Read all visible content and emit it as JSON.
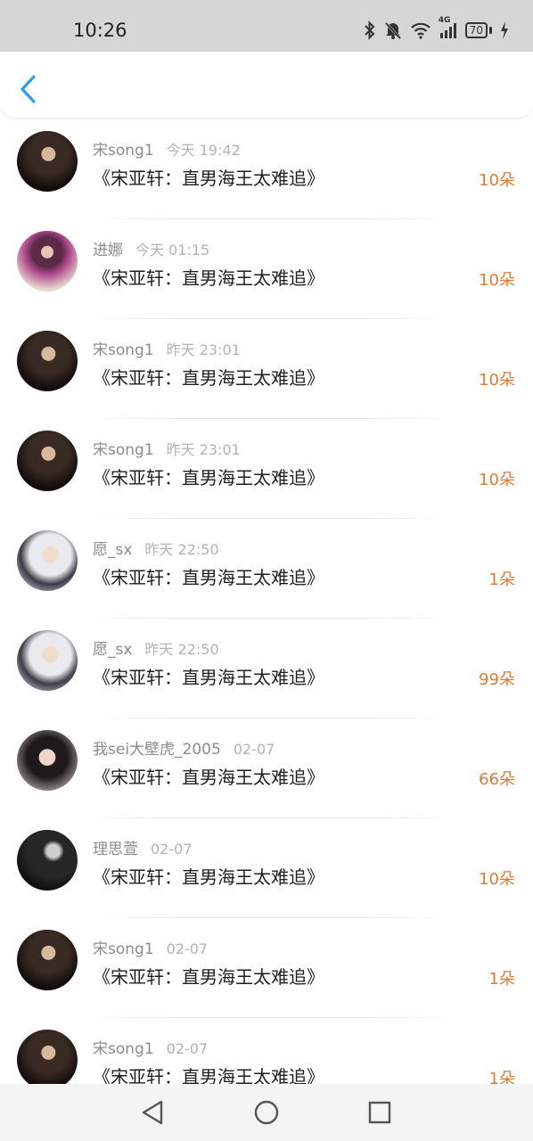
{
  "status_bar": {
    "time": "10:26",
    "network_label": "4G",
    "battery": "70",
    "icons": [
      "bluetooth-icon",
      "mute-icon",
      "wifi-icon",
      "signal-icon",
      "battery-icon",
      "charging-icon"
    ]
  },
  "header": {
    "back_icon": "chevron-left-icon"
  },
  "colors": {
    "accent": "#2a9df4",
    "count": "#e07a32",
    "name": "#8c8c8c"
  },
  "rows": [
    {
      "name": "宋song1",
      "time": "今天 19:42",
      "title": "《宋亚轩：直男海王太难追》",
      "count": "10朵"
    },
    {
      "name": "进娜",
      "time": "今天 01:15",
      "title": "《宋亚轩：直男海王太难追》",
      "count": "10朵"
    },
    {
      "name": "宋song1",
      "time": "昨天 23:01",
      "title": "《宋亚轩：直男海王太难追》",
      "count": "10朵"
    },
    {
      "name": "宋song1",
      "time": "昨天 23:01",
      "title": "《宋亚轩：直男海王太难追》",
      "count": "10朵"
    },
    {
      "name": "愿_sx",
      "time": "昨天 22:50",
      "title": "《宋亚轩：直男海王太难追》",
      "count": "1朵"
    },
    {
      "name": "愿_sx",
      "time": "昨天 22:50",
      "title": "《宋亚轩：直男海王太难追》",
      "count": "99朵"
    },
    {
      "name": "我sei大壁虎_2005",
      "time": "02-07",
      "title": "《宋亚轩：直男海王太难追》",
      "count": "66朵"
    },
    {
      "name": "理思萱",
      "time": "02-07",
      "title": "《宋亚轩：直男海王太难追》",
      "count": "10朵"
    },
    {
      "name": "宋song1",
      "time": "02-07",
      "title": "《宋亚轩：直男海王太难追》",
      "count": "1朵"
    },
    {
      "name": "宋song1",
      "time": "02-07",
      "title": "《宋亚轩：直男海王太难追》",
      "count": "1朵"
    }
  ],
  "nav": {
    "back": "back-triangle-icon",
    "home": "home-circle-icon",
    "recents": "recents-square-icon"
  }
}
